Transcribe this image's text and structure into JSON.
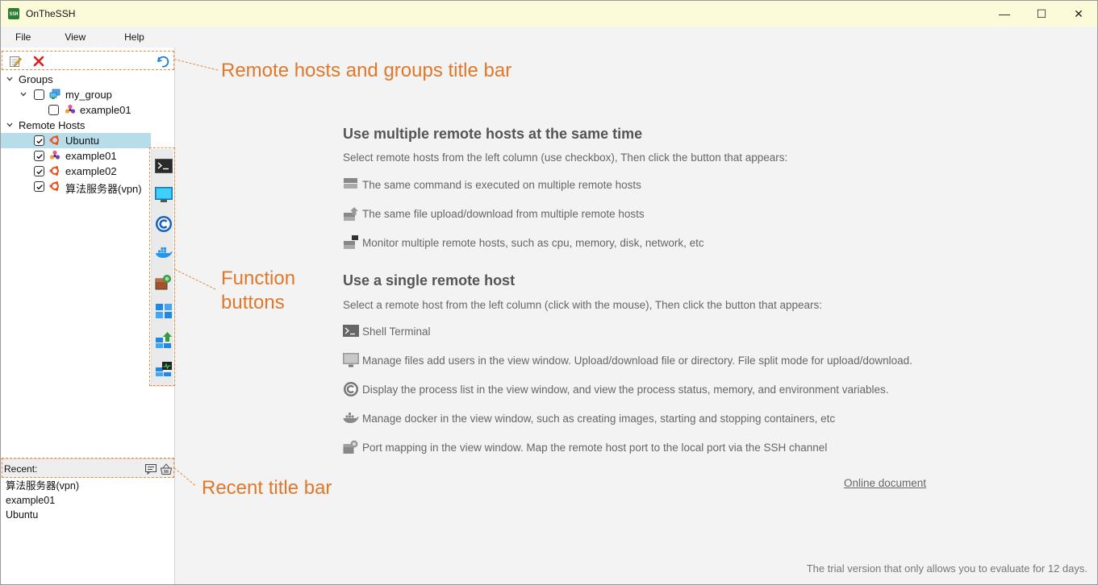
{
  "window": {
    "title": "OnTheSSH",
    "app_icon_text": "SSH",
    "controls": {
      "minimize": "—",
      "maximize": "☐",
      "close": "✕"
    }
  },
  "menu": [
    "File",
    "View",
    "Help"
  ],
  "hosts_toolbar": {
    "icons": [
      "edit-icon",
      "delete-icon",
      "refresh-icon"
    ]
  },
  "tree": {
    "groups_label": "Groups",
    "group_name": "my_group",
    "group_child": "example01",
    "remote_hosts_label": "Remote Hosts",
    "hosts": [
      "Ubuntu",
      "example01",
      "example02",
      "算法服务器(vpn)"
    ],
    "selected_host": "Ubuntu"
  },
  "function_buttons": [
    "shell-terminal-icon",
    "file-manager-icon",
    "process-icon",
    "docker-icon",
    "port-mapping-icon",
    "multi-command-icon",
    "multi-upload-icon",
    "multi-monitor-icon"
  ],
  "recent": {
    "label": "Recent:",
    "items": [
      "算法服务器(vpn)",
      "example01",
      "Ubuntu"
    ]
  },
  "annotations": {
    "title_bar": "Remote hosts and groups title bar",
    "function_line1": "Function",
    "function_line2": "buttons",
    "recent_bar": "Recent title bar"
  },
  "main": {
    "multi_heading": "Use multiple remote hosts at the same time",
    "multi_sub": "Select remote hosts from the left column (use checkbox), Then click the button that appears:",
    "multi_features": [
      "The same command is executed on multiple remote hosts",
      "The same file upload/download from multiple remote hosts",
      "Monitor multiple remote hosts, such as cpu, memory, disk, network, etc"
    ],
    "single_heading": "Use a single remote host",
    "single_sub": "Select a remote host from the left column (click with the mouse), Then click the button that appears:",
    "single_features": [
      "Shell Terminal",
      "Manage files add users in the view window. Upload/download file or directory. File split mode for upload/download.",
      "Display the process list in the view window, and view the process status, memory, and environment variables.",
      "Manage docker in the view window, such as creating images, starting and stopping containers, etc",
      "Port mapping in the view window. Map the remote host port to the local port via the SSH channel"
    ],
    "online_doc": "Online document",
    "trial_notice": "The trial version that only allows you to evaluate for 12 days."
  },
  "colors": {
    "accent_orange": "#e0782b",
    "selection": "#b7dcea",
    "titlebar": "#fbfbd9"
  }
}
